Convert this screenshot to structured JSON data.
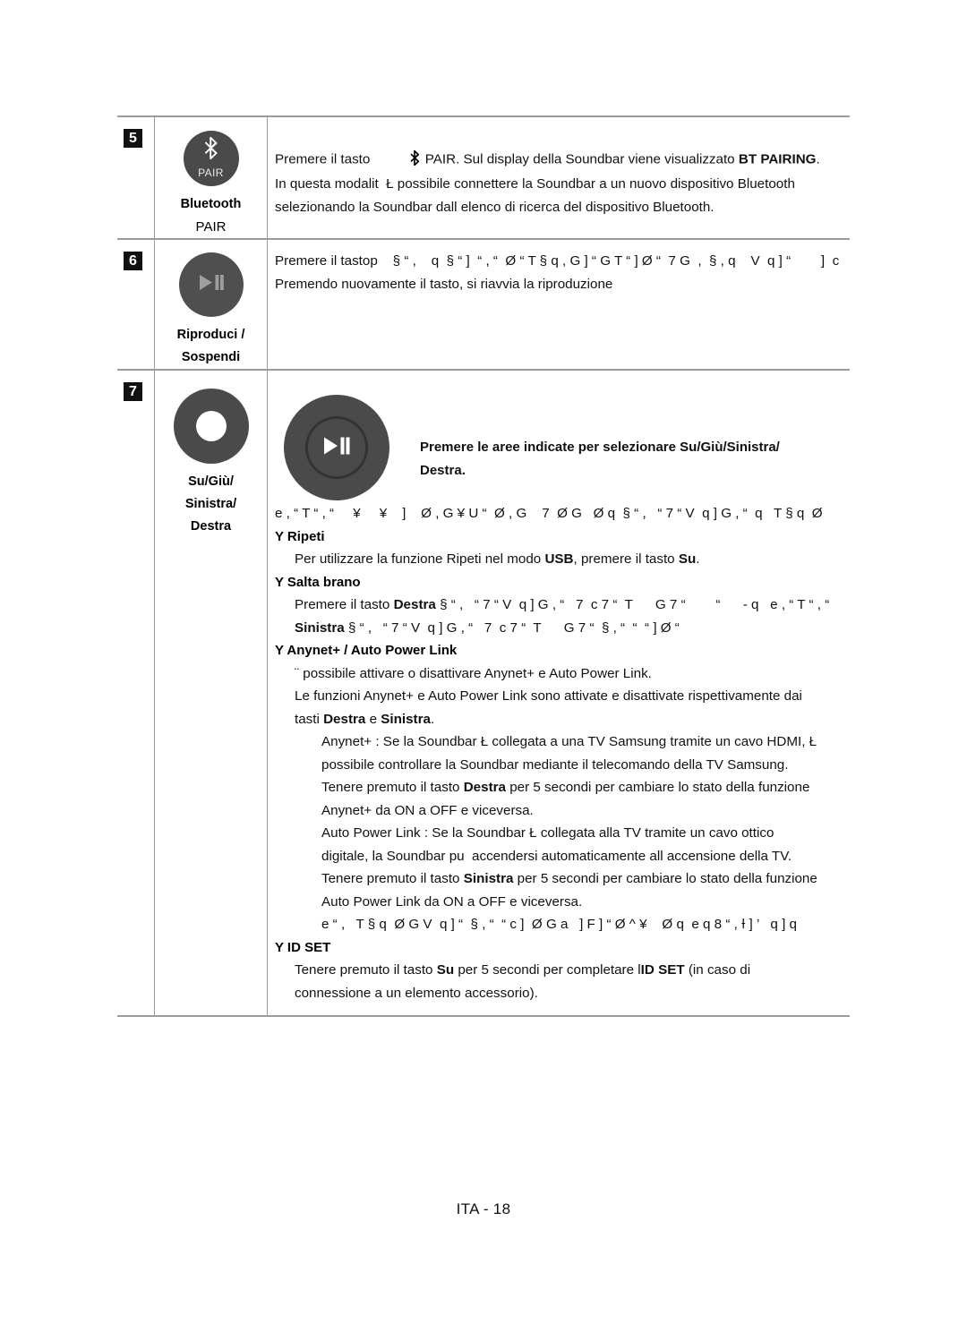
{
  "document": {
    "footer": "ITA - 18"
  },
  "table": {
    "rows": [
      {
        "number": "5",
        "icon": {
          "glyph": "bluetooth-glyph",
          "inner_label": "PAIR"
        },
        "caption_bold": "Bluetooth",
        "caption_light": "PAIR",
        "lines": [
          {
            "text": "Premere il tasto ",
            "bold": false
          },
          {
            "text": "BT PAIRING",
            "bold": true
          }
        ],
        "paragraph_line1_a": "Premere il tasto",
        "paragraph_line1_icon": "bluetooth-inline-icon",
        "paragraph_line1_b": " PAIR. Sul display della Soundbar viene visualizzato ",
        "paragraph_line1_bold": "BT PAIRING",
        "paragraph_line1_c": ".",
        "paragraph_line2": "In questa modalit  Ł possibile connettere la Soundbar a un nuovo dispositivo Bluetooth",
        "paragraph_line3": "selezionando la Soundbar dall elenco di ricerca del dispositivo Bluetooth."
      },
      {
        "number": "6",
        "icon": {
          "glyph": "play-pause-glyph"
        },
        "caption_bold_1": "Riproduci /",
        "caption_bold_2": "Sospendi",
        "paragraph_line1_a": "Premere il tasto",
        "paragraph_line1_garbled": "p    § “ ,    q  § “ ]  “ , “  Ø “ T § q , G ] “ G T “ ] Ø “  7 G  ,  § , q    V  q ] “        ]  c",
        "paragraph_line2": "Premendo nuovamente il tasto, si riavvia la riproduzione"
      },
      {
        "number": "7",
        "icon_ring": "ring-button-icon",
        "caption_bold_1": "Su/Giù/",
        "caption_bold_2": "Sinistra/",
        "caption_bold_3": "Destra",
        "disc_icon": "play-pause-disc-icon",
        "head_line1": "Premere le aree indicate per selezionare Su/Giù/Sinistra/",
        "head_line2": "Destra.",
        "garbled_line_1": "e , “ T “ , “     ¥     ¥    ]    Ø , G ¥ U “  Ø , G    7  Ø G   Ø q  § “ ,   “ 7 “ V  q ] G , “  q   T § q  Ø",
        "bullet_repeat_marker": "Y",
        "bullet_repeat_label": "Ripeti",
        "repeat_line_a": "Per utilizzare la funzione Ripeti nel modo ",
        "repeat_line_usb": "USB",
        "repeat_line_b": ", premere il tasto ",
        "repeat_line_su": "Su",
        "repeat_line_c": ".",
        "bullet_skip_marker": "Y",
        "bullet_skip_label": "Salta brano",
        "skip_line1_a": "Premere il tasto ",
        "skip_line1_destra": "Destra",
        "skip_line1_garbled": " § “ ,   “ 7 “ V  q ] G , “   7  c 7 “  T      G 7 “        “      - q   e , “ T “ , “",
        "skip_line2_sinistra": "Sinistra",
        "skip_line2_garbled": " § “ ,   “ 7 “ V  q ] G , “   7  c 7 “  T      G 7 “  § , “  “  “ ] Ø “",
        "bullet_anynet_marker": "Y",
        "bullet_anynet_label": "Anynet+ / Auto Power Link",
        "anynet_line1": "¨ possibile attivare o disattivare Anynet+ e Auto Power Link.",
        "anynet_line2": "Le funzioni Anynet+ e Auto Power Link sono attivate e disattivate rispettivamente dai",
        "anynet_line3_a": "tasti ",
        "anynet_line3_destra": "Destra",
        "anynet_line3_b": " e ",
        "anynet_line3_sinistra": "Sinistra",
        "anynet_line3_c": ".",
        "anynet_detail_1": "Anynet+ : Se la Soundbar Ł collegata a una TV Samsung tramite un cavo HDMI, Ł",
        "anynet_detail_2": "possibile controllare la Soundbar mediante il telecomando della TV Samsung.",
        "anynet_detail_3_a": "Tenere premuto il tasto ",
        "anynet_detail_3_destra": "Destra",
        "anynet_detail_3_b": " per 5 secondi per cambiare lo stato della funzione",
        "anynet_detail_4": "Anynet+ da ON a OFF e viceversa.",
        "apl_detail_1": "Auto Power Link : Se la Soundbar Ł collegata alla TV tramite un cavo ottico",
        "apl_detail_2": "digitale, la Soundbar pu  accendersi automaticamente all accensione della TV.",
        "apl_detail_3_a": "Tenere premuto il tasto ",
        "apl_detail_3_sinistra": "Sinistra",
        "apl_detail_3_b": " per 5 secondi per cambiare lo stato della funzione",
        "apl_detail_4": "Auto Power Link da ON a OFF e viceversa.",
        "garbled_line_2": "e “ ,   T § q  Ø G V  q ] “  § , “  “ c ]  Ø G a   ] F ] “ Ø ^ ¥    Ø q  e q 8 “ , Ɨ ] ’   q ] q",
        "bullet_idset_marker": "Y",
        "bullet_idset_label": "ID SET",
        "idset_line1_a": "Tenere premuto il tasto ",
        "idset_line1_su": "Su",
        "idset_line1_b": " per 5 secondi per completare l",
        "idset_line1_idset": "ID SET",
        "idset_line1_c": " (in caso di",
        "idset_line2": "connessione a un elemento accessorio)."
      }
    ]
  },
  "icons": {
    "bluetooth": "ᛒ",
    "play_pause": "▶▐▐",
    "bullet_marker": "Y"
  }
}
